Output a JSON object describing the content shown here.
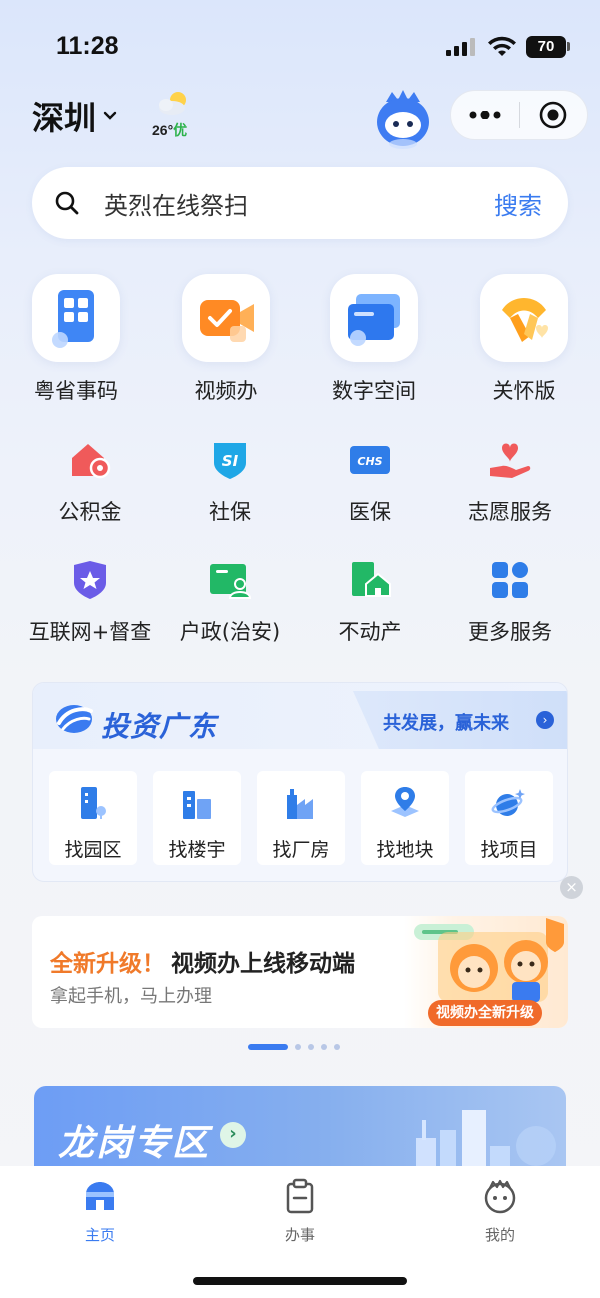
{
  "status_bar": {
    "time": "11:28",
    "battery": "70"
  },
  "header": {
    "city": "深圳",
    "weather": {
      "temp": "26°",
      "aqi": "优"
    }
  },
  "search": {
    "placeholder": "英烈在线祭扫",
    "button": "搜索"
  },
  "features": [
    {
      "label": "粤省事码",
      "icon": "qr-code-card-icon"
    },
    {
      "label": "视频办",
      "icon": "video-camera-icon"
    },
    {
      "label": "数字空间",
      "icon": "folder-cards-icon"
    },
    {
      "label": "关怀版",
      "icon": "care-ribbon-icon"
    }
  ],
  "services": [
    {
      "label": "公积金",
      "icon": "housing-fund-icon"
    },
    {
      "label": "社保",
      "icon": "social-security-shield-icon"
    },
    {
      "label": "医保",
      "icon": "chs-medical-insurance-icon"
    },
    {
      "label": "志愿服务",
      "icon": "heart-hand-icon"
    },
    {
      "label": "互联网+督查",
      "icon": "star-shield-icon"
    },
    {
      "label": "户政(治安)",
      "icon": "id-card-person-icon"
    },
    {
      "label": "不动产",
      "icon": "real-estate-icon"
    },
    {
      "label": "更多服务",
      "icon": "grid-apps-icon"
    }
  ],
  "invest": {
    "title": "投资广东",
    "slogan": "共发展，赢未来",
    "items": [
      {
        "label": "找园区"
      },
      {
        "label": "找楼宇"
      },
      {
        "label": "找厂房"
      },
      {
        "label": "找地块"
      },
      {
        "label": "找项目"
      }
    ]
  },
  "banner": {
    "headline_accent": "全新升级！",
    "headline": "视频办上线移动端",
    "subtitle": "拿起手机，马上办理",
    "badge": "视频办全新升级",
    "page_count": 5,
    "active_page": 1
  },
  "zone": {
    "title": "龙岗专区"
  },
  "tabbar": [
    {
      "label": "主页",
      "active": true
    },
    {
      "label": "办事",
      "active": false
    },
    {
      "label": "我的",
      "active": false
    }
  ],
  "colors": {
    "accent": "#3a7bf0",
    "orange": "#f07a2a",
    "red": "#e85050",
    "green": "#2cc36b"
  }
}
